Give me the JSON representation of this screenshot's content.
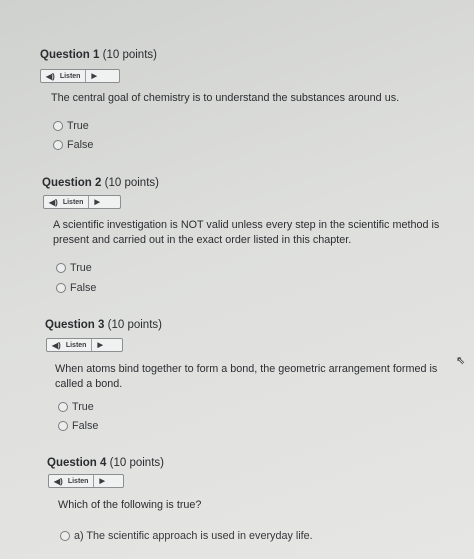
{
  "questions": [
    {
      "title": "Question 1",
      "points": "(10 points)",
      "listen_label": "Listen",
      "text": "The central goal of chemistry is to understand the substances around us.",
      "options": [
        "True",
        "False"
      ]
    },
    {
      "title": "Question 2",
      "points": "(10 points)",
      "listen_label": "Listen",
      "text": "A scientific investigation is NOT valid unless every step in the scientific method is present and carried out in the exact order listed in this chapter.",
      "options": [
        "True",
        "False"
      ]
    },
    {
      "title": "Question 3",
      "points": "(10 points)",
      "listen_label": "Listen",
      "text": "When atoms bind together to form a bond, the geometric arrangement formed is called a bond.",
      "options": [
        "True",
        "False"
      ]
    },
    {
      "title": "Question 4",
      "points": "(10 points)",
      "listen_label": "Listen",
      "text": "Which of the following is true?",
      "options": [
        "a) The scientific approach is used in everyday life."
      ]
    }
  ],
  "icons": {
    "speaker": "speaker-icon",
    "play": "play-icon",
    "cursor": "mouse-cursor-icon"
  }
}
